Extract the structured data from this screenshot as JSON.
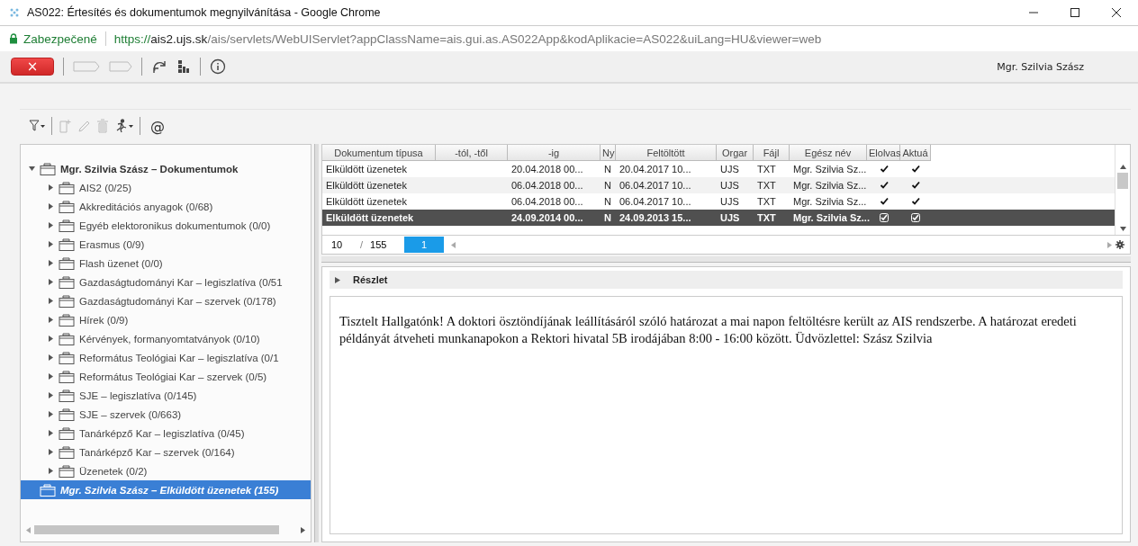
{
  "window": {
    "title": "AS022: Értesítés és dokumentumok megnyilvánítása - Google Chrome"
  },
  "address_bar": {
    "security_label": "Zabezpečené",
    "url_scheme": "https://",
    "url_host": "ais2.ujs.sk",
    "url_path": "/ais/servlets/WebUIServlet?appClassName=ais.gui.as.AS022App&kodAplikacie=AS022&uiLang=HU&viewer=web"
  },
  "toolbar": {
    "close_label": "×",
    "user": "Mgr. Szilvia Szász"
  },
  "doc_toolbar": {
    "at_label": "@"
  },
  "tree": [
    {
      "label": "Mgr. Szilvia Szász – Dokumentumok",
      "bold": true,
      "expanded": true,
      "selected": false,
      "children": [
        {
          "label": "AIS2 (0/25)",
          "expanded": false,
          "selected": false
        },
        {
          "label": "Akkreditációs anyagok (0/68)",
          "expanded": false,
          "selected": false
        },
        {
          "label": "Egyéb elektoronikus dokumentumok (0/0)",
          "expanded": false,
          "selected": false
        },
        {
          "label": "Erasmus (0/9)",
          "expanded": false,
          "selected": false
        },
        {
          "label": "Flash üzenet (0/0)",
          "expanded": false,
          "selected": false
        },
        {
          "label": "Gazdaságtudományi Kar – legiszlatíva (0/51",
          "expanded": false,
          "selected": false
        },
        {
          "label": "Gazdaságtudományi Kar – szervek (0/178)",
          "expanded": false,
          "selected": false
        },
        {
          "label": "Hírek (0/9)",
          "expanded": false,
          "selected": false
        },
        {
          "label": "Kérvények, formanyomtatványok (0/10)",
          "expanded": false,
          "selected": false
        },
        {
          "label": "Református Teológiai Kar – legiszlatíva (0/1",
          "expanded": false,
          "selected": false
        },
        {
          "label": "Református Teológiai Kar – szervek (0/5)",
          "expanded": false,
          "selected": false
        },
        {
          "label": "SJE – legiszlatíva (0/145)",
          "expanded": false,
          "selected": false
        },
        {
          "label": "SJE – szervek (0/663)",
          "expanded": false,
          "selected": false
        },
        {
          "label": "Tanárképző Kar – legiszlatíva (0/45)",
          "expanded": false,
          "selected": false
        },
        {
          "label": "Tanárképző Kar – szervek (0/164)",
          "expanded": false,
          "selected": false
        },
        {
          "label": "Üzenetek (0/2)",
          "expanded": false,
          "selected": false
        }
      ]
    },
    {
      "label": "Mgr. Szilvia Szász – Elküldött üzenetek (155)",
      "bold": true,
      "selected": true
    }
  ],
  "table": {
    "columns": [
      "Dokumentum típusa",
      "-tól, -től",
      "-ig",
      "Ny",
      "Feltöltött",
      "Orgar",
      "Fájl",
      "Egész név",
      "Elolvas",
      "Aktuá"
    ],
    "rows": [
      {
        "cells": [
          "Elküldött üzenetek",
          "",
          "20.04.2018 00...",
          "N",
          "20.04.2017 10...",
          "UJS",
          "TXT",
          "Mgr. Szilvia Sz..."
        ],
        "read": true,
        "current": true,
        "selected": false
      },
      {
        "cells": [
          "Elküldött üzenetek",
          "",
          "06.04.2018 00...",
          "N",
          "06.04.2017 10...",
          "UJS",
          "TXT",
          "Mgr. Szilvia Sz..."
        ],
        "read": true,
        "current": true,
        "selected": false
      },
      {
        "cells": [
          "Elküldött üzenetek",
          "",
          "06.04.2018 00...",
          "N",
          "06.04.2017 10...",
          "UJS",
          "TXT",
          "Mgr. Szilvia Sz..."
        ],
        "read": true,
        "current": true,
        "selected": false
      },
      {
        "cells": [
          "Elküldött üzenetek",
          "",
          "24.09.2014 00...",
          "N",
          "24.09.2013 15...",
          "UJS",
          "TXT",
          "Mgr. Szilvia Sz..."
        ],
        "read": true,
        "current": true,
        "selected": true
      }
    ],
    "pager": {
      "page_size": "10",
      "separator": "/",
      "total": "155",
      "pages": [
        {
          "label": "1",
          "selected": true
        }
      ]
    }
  },
  "detail": {
    "title": "Részlet",
    "text": "Tisztelt Hallgatónk! A doktori ösztöndíjának leállításáról szóló határozat a mai napon feltöltésre került az AIS rendszerbe. A határozat eredeti példányát átveheti munkanapokon a Rektori hivatal 5B irodájában 8:00 - 16:00 között. Üdvözlettel: Szász Szilvia"
  }
}
